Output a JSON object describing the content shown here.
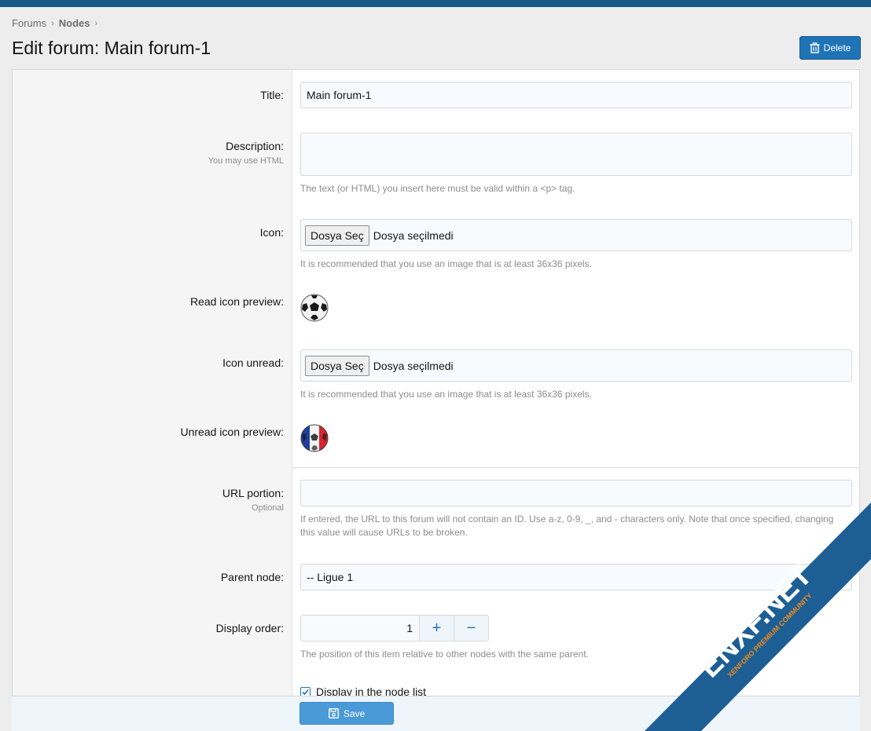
{
  "breadcrumb": {
    "item1": "Forums",
    "item2": "Nodes"
  },
  "header": {
    "title": "Edit forum: Main forum-1",
    "delete_label": "Delete"
  },
  "form": {
    "title_label": "Title:",
    "title_value": "Main forum-1",
    "description_label": "Description:",
    "description_hint": "You may use HTML",
    "description_value": "",
    "description_explain": "The text (or HTML) you insert here must be valid within a <p> tag.",
    "icon_label": "Icon:",
    "icon_button": "Dosya Seç",
    "icon_file_text": "Dosya seçilmedi",
    "icon_explain": "It is recommended that you use an image that is at least 36x36 pixels.",
    "read_preview_label": "Read icon preview:",
    "icon_unread_label": "Icon unread:",
    "icon_unread_button": "Dosya Seç",
    "icon_unread_file_text": "Dosya seçilmedi",
    "icon_unread_explain": "It is recommended that you use an image that is at least 36x36 pixels.",
    "unread_preview_label": "Unread icon preview:",
    "url_label": "URL portion:",
    "url_hint": "Optional",
    "url_value": "",
    "url_explain": "If entered, the URL to this forum will not contain an ID. Use a-z, 0-9, _, and - characters only. Note that once specified, changing this value will cause URLs to be broken.",
    "parent_label": "Parent node:",
    "parent_value": "-- Ligue 1",
    "order_label": "Display order:",
    "order_value": "1",
    "order_plus": "+",
    "order_minus": "−",
    "order_explain": "The position of this item relative to other nodes with the same parent.",
    "display_list_label": "Display in the node list"
  },
  "footer": {
    "save_label": "Save"
  },
  "watermark": {
    "text": "ENXF.NET",
    "subtext": "XENFORO PREMIUM COMMUNITY"
  },
  "colors": {
    "accent": "#1f74b8",
    "topbar": "#185886",
    "watermark_blue": "#1d5f95",
    "watermark_orange": "#f08a1c"
  }
}
